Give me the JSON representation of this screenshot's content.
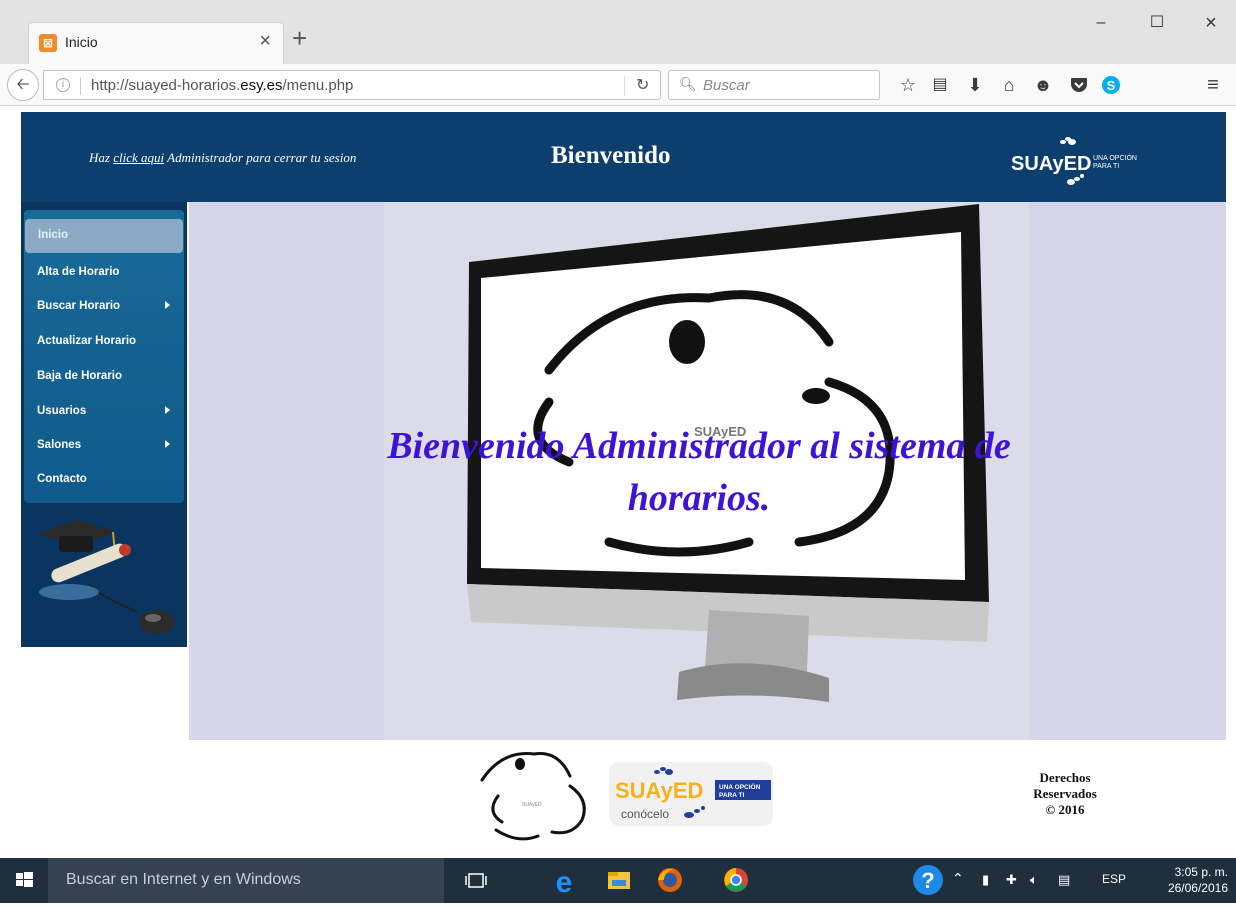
{
  "browser": {
    "tab_title": "Inicio",
    "url_prefix": "http://suayed-horarios.",
    "url_domain": "esy.es",
    "url_path": "/menu.php",
    "search_placeholder": "Buscar",
    "window_controls": [
      "minimize-icon",
      "maximize-icon",
      "close-icon"
    ],
    "toolbar_icons": [
      "bookmark-star-icon",
      "reading-list-icon",
      "download-icon",
      "home-icon",
      "chat-icon",
      "pocket-icon",
      "skype-icon",
      "menu-icon"
    ]
  },
  "header": {
    "logout_prefix": "Haz ",
    "logout_link": "click aqui",
    "logout_suffix": " Administrador para cerrar tu sesion",
    "title": "Bienvenido",
    "logo_text": "SUAyED",
    "logo_tagline_1": "UNA OPCIÓN",
    "logo_tagline_2": "PARA TI"
  },
  "menu": {
    "items": [
      {
        "label": "Inicio",
        "submenu": false,
        "active": true
      },
      {
        "label": "Alta de Horario",
        "submenu": false
      },
      {
        "label": "Buscar Horario",
        "submenu": true
      },
      {
        "label": "Actualizar Horario",
        "submenu": false
      },
      {
        "label": "Baja de Horario",
        "submenu": false
      },
      {
        "label": "Usuarios",
        "submenu": true
      },
      {
        "label": "Salones",
        "submenu": true
      },
      {
        "label": "Contacto",
        "submenu": false
      }
    ]
  },
  "hero": {
    "message": "Bienvenido Administrador al sistema de horarios.",
    "monitor_logo": "SUAyED"
  },
  "footer": {
    "logo_text": "SUAyED",
    "logo_tagline_1": "UNA OPCIÓN",
    "logo_tagline_2": "PARA TI",
    "logo_cta": "conócelo",
    "rights_1": "Derechos",
    "rights_2": "Reservados",
    "rights_3": "© 2016"
  },
  "taskbar": {
    "search_placeholder": "Buscar en Internet y en Windows",
    "language": "ESP",
    "time": "3:05 p. m.",
    "date": "26/06/2016"
  },
  "colors": {
    "header_bg": "#0c3f6e",
    "menu_bg": "#1a6a98",
    "hero_bg": "#d7d6e9",
    "hero_text": "#3d14d4"
  }
}
